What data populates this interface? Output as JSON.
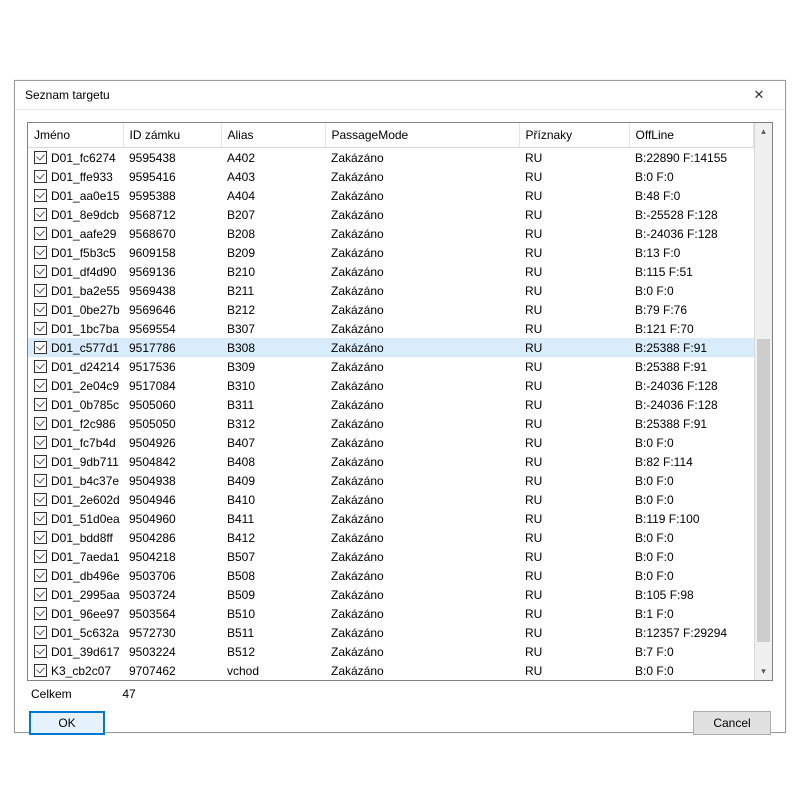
{
  "window": {
    "title": "Seznam targetu",
    "close_symbol": "✕"
  },
  "columns": {
    "name": "Jméno",
    "lock_id": "ID zámku",
    "alias": "Alias",
    "passage_mode": "PassageMode",
    "flags": "Příznaky",
    "offline": "OffLine"
  },
  "rows": [
    {
      "checked": true,
      "name": "D01_fc6274",
      "lock_id": "9595438",
      "alias": "A402",
      "passage_mode": "Zakázáno",
      "flags": "RU",
      "offline": "B:22890 F:14155"
    },
    {
      "checked": true,
      "name": "D01_ffe933",
      "lock_id": "9595416",
      "alias": "A403",
      "passage_mode": "Zakázáno",
      "flags": "RU",
      "offline": "B:0 F:0"
    },
    {
      "checked": true,
      "name": "D01_aa0e15",
      "lock_id": "9595388",
      "alias": "A404",
      "passage_mode": "Zakázáno",
      "flags": "RU",
      "offline": "B:48 F:0"
    },
    {
      "checked": true,
      "name": "D01_8e9dcb",
      "lock_id": "9568712",
      "alias": "B207",
      "passage_mode": "Zakázáno",
      "flags": "RU",
      "offline": "B:-25528 F:128"
    },
    {
      "checked": true,
      "name": "D01_aafe29",
      "lock_id": "9568670",
      "alias": "B208",
      "passage_mode": "Zakázáno",
      "flags": "RU",
      "offline": "B:-24036 F:128"
    },
    {
      "checked": true,
      "name": "D01_f5b3c5",
      "lock_id": "9609158",
      "alias": "B209",
      "passage_mode": "Zakázáno",
      "flags": "RU",
      "offline": "B:13 F:0"
    },
    {
      "checked": true,
      "name": "D01_df4d90",
      "lock_id": "9569136",
      "alias": "B210",
      "passage_mode": "Zakázáno",
      "flags": "RU",
      "offline": "B:115 F:51"
    },
    {
      "checked": true,
      "name": "D01_ba2e55",
      "lock_id": "9569438",
      "alias": "B211",
      "passage_mode": "Zakázáno",
      "flags": "RU",
      "offline": "B:0 F:0"
    },
    {
      "checked": true,
      "name": "D01_0be27b",
      "lock_id": "9569646",
      "alias": "B212",
      "passage_mode": "Zakázáno",
      "flags": "RU",
      "offline": "B:79 F:76"
    },
    {
      "checked": true,
      "name": "D01_1bc7ba",
      "lock_id": "9569554",
      "alias": "B307",
      "passage_mode": "Zakázáno",
      "flags": "RU",
      "offline": "B:121 F:70"
    },
    {
      "checked": true,
      "name": "D01_c577d1",
      "lock_id": "9517786",
      "alias": "B308",
      "passage_mode": "Zakázáno",
      "flags": "RU",
      "offline": "B:25388 F:91",
      "selected": true
    },
    {
      "checked": true,
      "name": "D01_d24214",
      "lock_id": "9517536",
      "alias": "B309",
      "passage_mode": "Zakázáno",
      "flags": "RU",
      "offline": "B:25388 F:91"
    },
    {
      "checked": true,
      "name": "D01_2e04c9",
      "lock_id": "9517084",
      "alias": "B310",
      "passage_mode": "Zakázáno",
      "flags": "RU",
      "offline": "B:-24036 F:128"
    },
    {
      "checked": true,
      "name": "D01_0b785c",
      "lock_id": "9505060",
      "alias": "B311",
      "passage_mode": "Zakázáno",
      "flags": "RU",
      "offline": "B:-24036 F:128"
    },
    {
      "checked": true,
      "name": "D01_f2c986",
      "lock_id": "9505050",
      "alias": "B312",
      "passage_mode": "Zakázáno",
      "flags": "RU",
      "offline": "B:25388 F:91"
    },
    {
      "checked": true,
      "name": "D01_fc7b4d",
      "lock_id": "9504926",
      "alias": "B407",
      "passage_mode": "Zakázáno",
      "flags": "RU",
      "offline": "B:0 F:0"
    },
    {
      "checked": true,
      "name": "D01_9db711",
      "lock_id": "9504842",
      "alias": "B408",
      "passage_mode": "Zakázáno",
      "flags": "RU",
      "offline": "B:82 F:114"
    },
    {
      "checked": true,
      "name": "D01_b4c37e",
      "lock_id": "9504938",
      "alias": "B409",
      "passage_mode": "Zakázáno",
      "flags": "RU",
      "offline": "B:0 F:0"
    },
    {
      "checked": true,
      "name": "D01_2e602d",
      "lock_id": "9504946",
      "alias": "B410",
      "passage_mode": "Zakázáno",
      "flags": "RU",
      "offline": "B:0 F:0"
    },
    {
      "checked": true,
      "name": "D01_51d0ea",
      "lock_id": "9504960",
      "alias": "B411",
      "passage_mode": "Zakázáno",
      "flags": "RU",
      "offline": "B:119 F:100"
    },
    {
      "checked": true,
      "name": "D01_bdd8ff",
      "lock_id": "9504286",
      "alias": "B412",
      "passage_mode": "Zakázáno",
      "flags": "RU",
      "offline": "B:0 F:0"
    },
    {
      "checked": true,
      "name": "D01_7aeda1",
      "lock_id": "9504218",
      "alias": "B507",
      "passage_mode": "Zakázáno",
      "flags": "RU",
      "offline": "B:0 F:0"
    },
    {
      "checked": true,
      "name": "D01_db496e",
      "lock_id": "9503706",
      "alias": "B508",
      "passage_mode": "Zakázáno",
      "flags": "RU",
      "offline": "B:0 F:0"
    },
    {
      "checked": true,
      "name": "D01_2995aa",
      "lock_id": "9503724",
      "alias": "B509",
      "passage_mode": "Zakázáno",
      "flags": "RU",
      "offline": "B:105 F:98"
    },
    {
      "checked": true,
      "name": "D01_96ee97",
      "lock_id": "9503564",
      "alias": "B510",
      "passage_mode": "Zakázáno",
      "flags": "RU",
      "offline": "B:1 F:0"
    },
    {
      "checked": true,
      "name": "D01_5c632a",
      "lock_id": "9572730",
      "alias": "B511",
      "passage_mode": "Zakázáno",
      "flags": "RU",
      "offline": "B:12357 F:29294"
    },
    {
      "checked": true,
      "name": "D01_39d617",
      "lock_id": "9503224",
      "alias": "B512",
      "passage_mode": "Zakázáno",
      "flags": "RU",
      "offline": "B:7 F:0"
    },
    {
      "checked": true,
      "name": "K3_cb2c07",
      "lock_id": "9707462",
      "alias": "vchod",
      "passage_mode": "Zakázáno",
      "flags": "RU",
      "offline": "B:0 F:0"
    }
  ],
  "status": {
    "total_label": "Celkem",
    "total_value": "47"
  },
  "buttons": {
    "ok": "OK",
    "cancel": "Cancel"
  },
  "scroll": {
    "up": "▴",
    "down": "▾"
  }
}
